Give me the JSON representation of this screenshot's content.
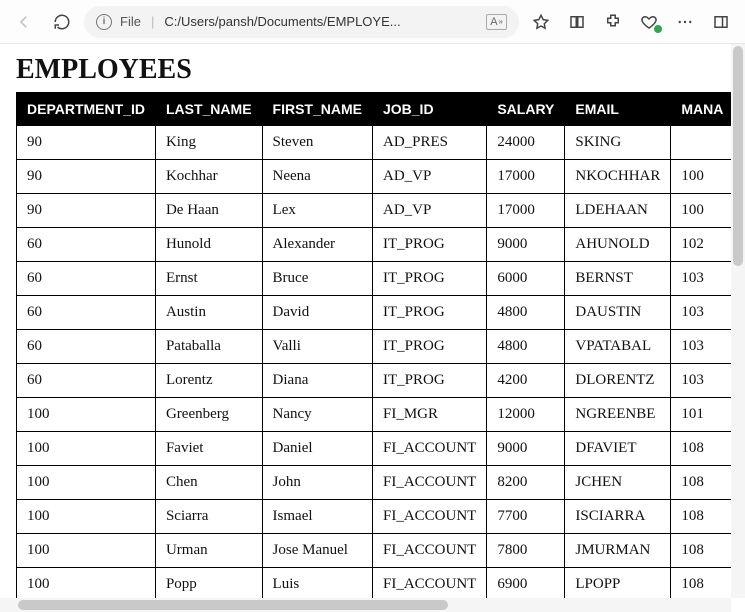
{
  "browser": {
    "address": {
      "file_label": "File",
      "path": "C:/Users/pansh/Documents/EMPLOYE..."
    }
  },
  "page": {
    "title": "EMPLOYEES",
    "columns": [
      "DEPARTMENT_ID",
      "LAST_NAME",
      "FIRST_NAME",
      "JOB_ID",
      "SALARY",
      "EMAIL",
      "MANAGER_ID"
    ],
    "last_column_visible": "MANA",
    "rows": [
      {
        "department_id": "90",
        "last_name": "King",
        "first_name": "Steven",
        "job_id": "AD_PRES",
        "salary": "24000",
        "email": "SKING",
        "manager_id": ""
      },
      {
        "department_id": "90",
        "last_name": "Kochhar",
        "first_name": "Neena",
        "job_id": "AD_VP",
        "salary": "17000",
        "email": "NKOCHHAR",
        "manager_id": "100"
      },
      {
        "department_id": "90",
        "last_name": "De Haan",
        "first_name": "Lex",
        "job_id": "AD_VP",
        "salary": "17000",
        "email": "LDEHAAN",
        "manager_id": "100"
      },
      {
        "department_id": "60",
        "last_name": "Hunold",
        "first_name": "Alexander",
        "job_id": "IT_PROG",
        "salary": "9000",
        "email": "AHUNOLD",
        "manager_id": "102"
      },
      {
        "department_id": "60",
        "last_name": "Ernst",
        "first_name": "Bruce",
        "job_id": "IT_PROG",
        "salary": "6000",
        "email": "BERNST",
        "manager_id": "103"
      },
      {
        "department_id": "60",
        "last_name": "Austin",
        "first_name": "David",
        "job_id": "IT_PROG",
        "salary": "4800",
        "email": "DAUSTIN",
        "manager_id": "103"
      },
      {
        "department_id": "60",
        "last_name": "Pataballa",
        "first_name": "Valli",
        "job_id": "IT_PROG",
        "salary": "4800",
        "email": "VPATABAL",
        "manager_id": "103"
      },
      {
        "department_id": "60",
        "last_name": "Lorentz",
        "first_name": "Diana",
        "job_id": "IT_PROG",
        "salary": "4200",
        "email": "DLORENTZ",
        "manager_id": "103"
      },
      {
        "department_id": "100",
        "last_name": "Greenberg",
        "first_name": "Nancy",
        "job_id": "FI_MGR",
        "salary": "12000",
        "email": "NGREENBE",
        "manager_id": "101"
      },
      {
        "department_id": "100",
        "last_name": "Faviet",
        "first_name": "Daniel",
        "job_id": "FI_ACCOUNT",
        "salary": "9000",
        "email": "DFAVIET",
        "manager_id": "108"
      },
      {
        "department_id": "100",
        "last_name": "Chen",
        "first_name": "John",
        "job_id": "FI_ACCOUNT",
        "salary": "8200",
        "email": "JCHEN",
        "manager_id": "108"
      },
      {
        "department_id": "100",
        "last_name": "Sciarra",
        "first_name": "Ismael",
        "job_id": "FI_ACCOUNT",
        "salary": "7700",
        "email": "ISCIARRA",
        "manager_id": "108"
      },
      {
        "department_id": "100",
        "last_name": "Urman",
        "first_name": "Jose Manuel",
        "job_id": "FI_ACCOUNT",
        "salary": "7800",
        "email": "JMURMAN",
        "manager_id": "108"
      },
      {
        "department_id": "100",
        "last_name": "Popp",
        "first_name": "Luis",
        "job_id": "FI_ACCOUNT",
        "salary": "6900",
        "email": "LPOPP",
        "manager_id": "108"
      }
    ]
  }
}
